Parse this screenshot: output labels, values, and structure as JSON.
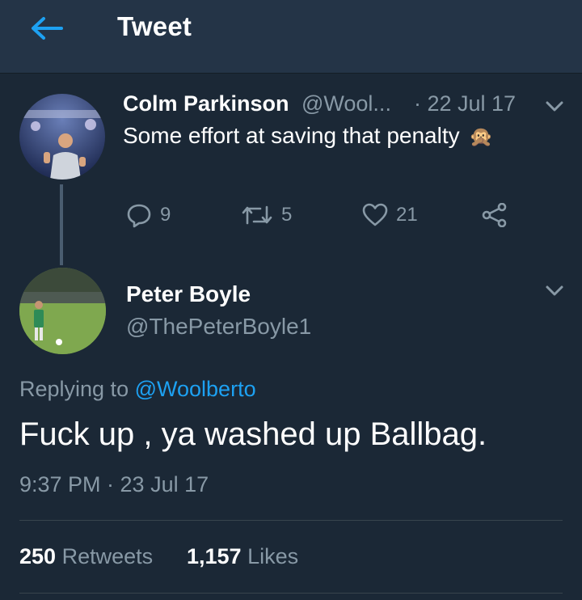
{
  "header": {
    "title": "Tweet"
  },
  "parent_tweet": {
    "author_name": "Colm Parkinson",
    "handle_truncated": "@Wool...",
    "date": "· 22 Jul 17",
    "text": "Some effort at saving that penalty",
    "emoji": "🙊",
    "replies": "9",
    "retweets": "5",
    "likes": "21"
  },
  "main_tweet": {
    "author_name": "Peter Boyle",
    "handle": "@ThePeterBoyle1",
    "replying_prefix": "Replying to",
    "replying_to": "@Woolberto",
    "text": "Fuck up , ya washed up Ballbag.",
    "timestamp": "9:37 PM · 23 Jul 17",
    "retweet_count": "250",
    "retweet_label": "Retweets",
    "like_count": "1,157",
    "like_label": "Likes"
  },
  "colors": {
    "background": "#1b2836",
    "header": "#243447",
    "accent": "#1da1f2",
    "muted_text": "#8899a6",
    "divider": "#38444d"
  },
  "icons": [
    "back-arrow-icon",
    "chevron-down-icon",
    "reply-icon",
    "retweet-icon",
    "heart-icon",
    "share-icon"
  ]
}
